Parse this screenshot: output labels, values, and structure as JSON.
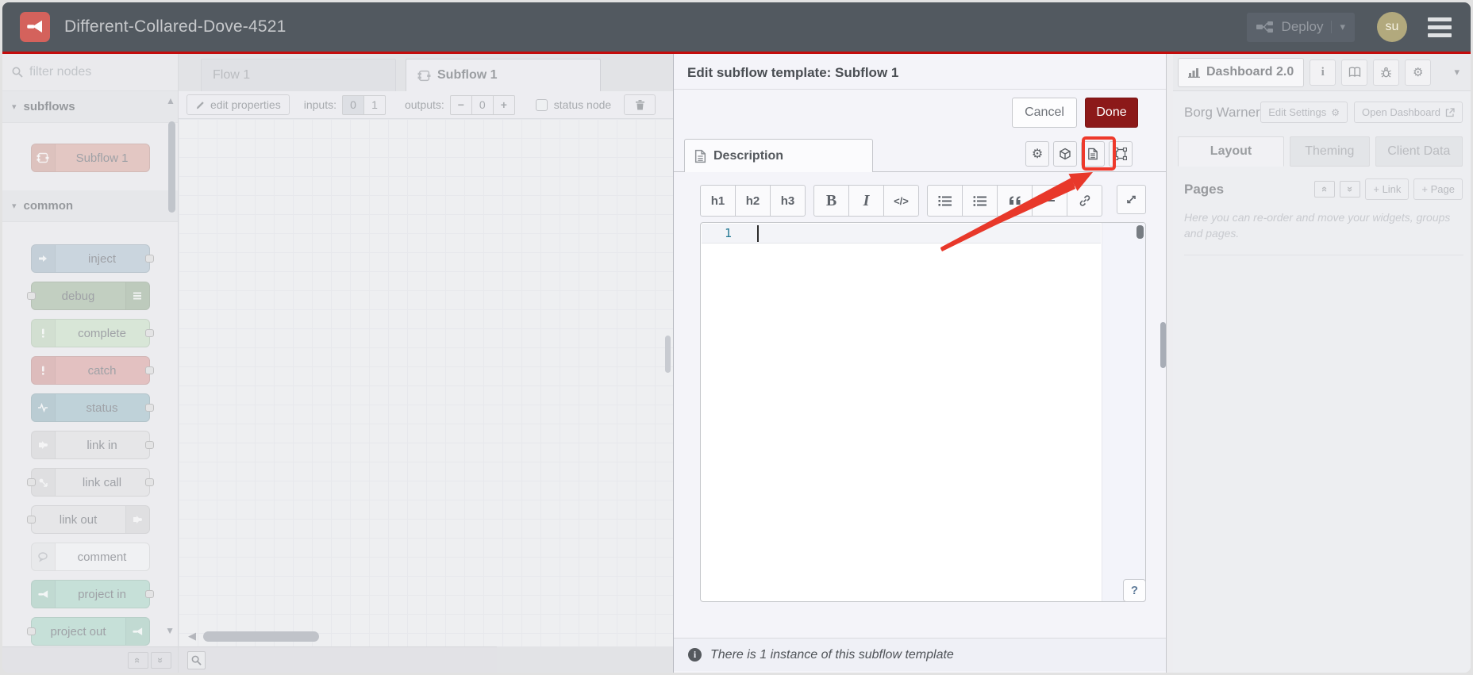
{
  "header": {
    "title": "Different-Collared-Dove-4521",
    "deploy_label": "Deploy",
    "avatar_initials": "su"
  },
  "palette": {
    "filter_placeholder": "filter nodes",
    "categories": [
      {
        "label": "subflows",
        "nodes": [
          {
            "label": "Subflow 1",
            "color": "#d8a59c"
          }
        ]
      },
      {
        "label": "common",
        "nodes": [
          {
            "label": "inject",
            "color": "#a9becd"
          },
          {
            "label": "debug",
            "color": "#9cb397"
          },
          {
            "label": "complete",
            "color": "#c3ddc0"
          },
          {
            "label": "catch",
            "color": "#d89a97"
          },
          {
            "label": "status",
            "color": "#96b9c4"
          },
          {
            "label": "link in",
            "color": "#dcdddf"
          },
          {
            "label": "link call",
            "color": "#dcdddf"
          },
          {
            "label": "link out",
            "color": "#dcdddf"
          },
          {
            "label": "comment",
            "color": "#eff0f2"
          },
          {
            "label": "project in",
            "color": "#a2d2c2"
          },
          {
            "label": "project out",
            "color": "#a2d2c2"
          }
        ]
      }
    ]
  },
  "workspace": {
    "tabs": [
      {
        "label": "Flow 1"
      },
      {
        "label": "Subflow 1"
      }
    ],
    "toolbar": {
      "edit_properties_label": "edit properties",
      "inputs_label": "inputs:",
      "inputs_options": [
        "0",
        "1"
      ],
      "outputs_label": "outputs:",
      "outputs_minus": "−",
      "outputs_value": "0",
      "outputs_plus": "+",
      "status_node_label": "status node"
    }
  },
  "tray": {
    "title": "Edit subflow template: Subflow 1",
    "cancel_label": "Cancel",
    "done_label": "Done",
    "tab_label": "Description",
    "md_toolbar": {
      "h1": "h1",
      "h2": "h2",
      "h3": "h3",
      "bold": "B",
      "italic": "I",
      "code": "</>"
    },
    "editor": {
      "line_number": "1",
      "content": ""
    },
    "help_label": "?",
    "footer_text": "There is 1 instance of this subflow template"
  },
  "sidebar": {
    "tab_label": "Dashboard 2.0",
    "board_name": "Borg Warner",
    "edit_settings_label": "Edit Settings",
    "open_dashboard_label": "Open Dashboard",
    "tabs": [
      "Layout",
      "Theming",
      "Client Data"
    ],
    "pages_label": "Pages",
    "add_link_label": "+ Link",
    "add_page_label": "+ Page",
    "help_text": "Here you can re-order and move your widgets, groups and pages."
  },
  "colors": {
    "header_bg": "#525960",
    "accent_red_line": "#c40c0c",
    "done_button": "#8c1919",
    "annotation_red": "#ee392b",
    "logo_red": "#d4625c"
  }
}
